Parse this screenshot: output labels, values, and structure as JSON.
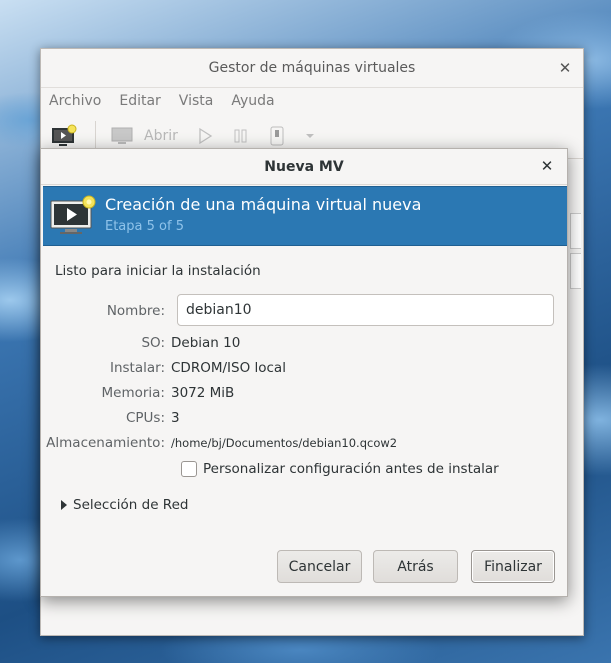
{
  "main_window": {
    "title": "Gestor de máquinas virtuales",
    "menu": [
      "Archivo",
      "Editar",
      "Vista",
      "Ayuda"
    ],
    "toolbar": {
      "open_label": "Abrir"
    }
  },
  "dialog": {
    "title": "Nueva MV",
    "banner_title": "Creación de una máquina virtual nueva",
    "banner_step": "Etapa 5 of 5",
    "intro": "Listo para iniciar la instalación",
    "name_label": "Nombre:",
    "name_value": "debian10",
    "fields": [
      {
        "label": "SO:",
        "value": "Debian 10"
      },
      {
        "label": "Instalar:",
        "value": "CDROM/ISO local"
      },
      {
        "label": "Memoria:",
        "value": "3072 MiB"
      },
      {
        "label": "CPUs:",
        "value": "3"
      },
      {
        "label": "Almacenamiento:",
        "value": "/home/bj/Documentos/debian10.qcow2"
      }
    ],
    "customize_label": "Personalizar configuración antes de instalar",
    "customize_checked": false,
    "network_label": "Selección de Red",
    "buttons": {
      "cancel": "Cancelar",
      "back": "Atrás",
      "finish": "Finalizar"
    }
  },
  "colors": {
    "banner": "#2b78b3",
    "banner_sub": "#8fc3ea"
  }
}
